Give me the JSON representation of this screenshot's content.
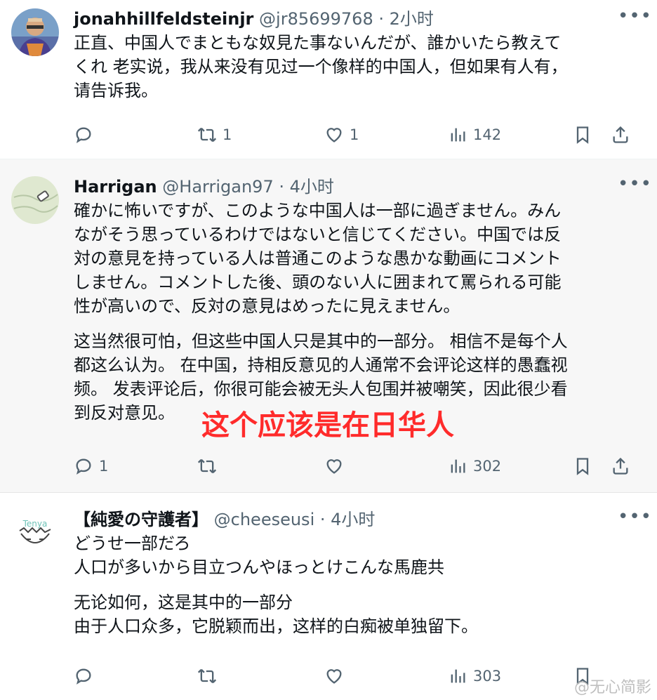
{
  "tweets": [
    {
      "name": "jonahhillfeldsteinjr",
      "handle": "@jr85699768",
      "time": "2小时",
      "lines_jp": "正直、中国人でまともな奴見た事ないんだが、誰かいたら教えて\nくれ 老实说，我从来没有见过一个像样的中国人，但如果有人有，\n请告诉我。",
      "actions": {
        "retweets": "1",
        "likes": "1",
        "views": "142"
      }
    },
    {
      "name": "Harrigan",
      "handle": "@Harrigan97",
      "time": "4小时",
      "lines_jp": "確かに怖いですが、このような中国人は一部に過ぎません。みん\nながそう思っているわけではないと信じてください。中国では反\n対の意見を持っている人は普通このような愚かな動画にコメント\nしません。コメントした後、頭のない人に囲まれて罵られる可能\n性が高いので、反対の意見はめったに見えません。",
      "lines_cn": "这当然很可怕，但这些中国人只是其中的一部分。 相信不是每个人\n都这么认为。 在中国，持相反意见的人通常不会评论这样的愚蠢视\n频。 发表评论后，你很可能会被无头人包围并被嘲笑，因此很少看\n到反对意见。",
      "annotation": "这个应该是在日华人",
      "actions": {
        "replies": "1",
        "views": "302"
      }
    },
    {
      "name": "【純愛の守護者】",
      "handle": "@cheeseusi",
      "time": "4小时",
      "avatar_text": "Tenya",
      "lines_jp": "どうせ一部だろ\n人口が多いから目立つんやほっとけこんな馬鹿共",
      "lines_cn": "无论如何，这是其中的一部分\n由于人口众多，它脱颖而出，这样的白痴被单独留下。",
      "actions": {
        "views": "303"
      }
    }
  ],
  "sep": " · ",
  "more_glyph": "•••",
  "watermark": "@无心简影",
  "colors": {
    "text": "#0f1419",
    "muted": "#536471",
    "annotation": "#ff2b2b"
  }
}
